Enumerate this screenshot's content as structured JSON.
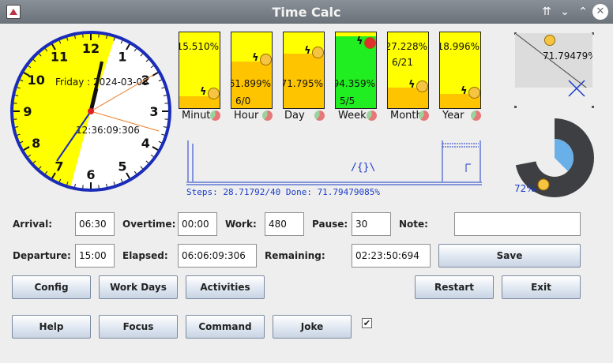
{
  "window": {
    "title": "Time Calc"
  },
  "clock": {
    "date_text": "Friday : 2024-03-08",
    "time_text": "12:36:09:306",
    "numbers": [
      "12",
      "1",
      "2",
      "3",
      "4",
      "5",
      "6",
      "7",
      "8",
      "9",
      "10",
      "11"
    ],
    "face_color": "#ffff00",
    "border_color": "#1a2cb8"
  },
  "tiles": [
    {
      "label": "Minute",
      "pct": "15.510%",
      "sub": "",
      "fill": 0.1551,
      "bg": "#ffff00",
      "fill_color": "#ffc400"
    },
    {
      "label": "Hour",
      "pct": "61.899%",
      "sub": "6/0",
      "fill": 0.61899,
      "bg": "#ffff00",
      "fill_color": "#ffc400"
    },
    {
      "label": "Day",
      "pct": "71.795%",
      "sub": "",
      "fill": 0.71795,
      "bg": "#ffff00",
      "fill_color": "#ffc400"
    },
    {
      "label": "Week",
      "pct": "94.359%",
      "sub": "5/5",
      "fill": 0.94359,
      "bg": "#ffff00",
      "fill_color": "#20ee20"
    },
    {
      "label": "Month",
      "pct": "27.228%",
      "sub": "6/21",
      "fill": 0.27228,
      "bg": "#ffff00",
      "fill_color": "#ffc400"
    },
    {
      "label": "Year",
      "pct": "18.996%",
      "sub": "",
      "fill": 0.18996,
      "bg": "#ffff00",
      "fill_color": "#ffc400"
    }
  ],
  "square": {
    "text": "71.79479%"
  },
  "pie": {
    "label": "72%",
    "value": 0.72
  },
  "walking": {
    "status": "Steps: 28.71792/40 Done: 71.79479085%"
  },
  "form": {
    "arrival_label": "Arrival:",
    "arrival_value": "06:30",
    "overtime_label": "Overtime:",
    "overtime_value": "00:00",
    "work_label": "Work:",
    "work_value": "480",
    "pause_label": "Pause:",
    "pause_value": "30",
    "note_label": "Note:",
    "note_value": "",
    "departure_label": "Departure:",
    "departure_value": "15:00",
    "elapsed_label": "Elapsed:",
    "elapsed_value": "06:06:09:306",
    "remaining_label": "Remaining:",
    "remaining_value": "02:23:50:694"
  },
  "buttons": {
    "save": "Save",
    "config": "Config",
    "work_days": "Work Days",
    "activities": "Activities",
    "restart": "Restart",
    "exit": "Exit",
    "help": "Help",
    "focus": "Focus",
    "command": "Command",
    "joke": "Joke"
  },
  "checkbox": {
    "checked": true,
    "mark": "✔"
  }
}
